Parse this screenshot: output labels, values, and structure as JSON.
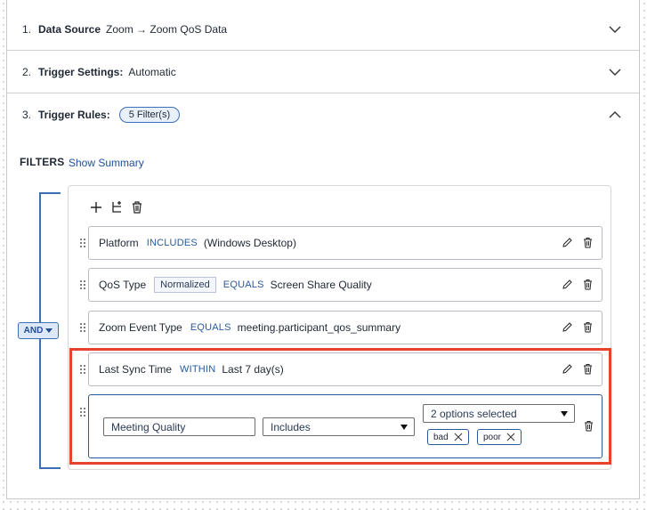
{
  "sections": [
    {
      "number": "1.",
      "title": "Data Source",
      "value": "Zoom → Zoom QoS Data"
    },
    {
      "number": "2.",
      "title": "Trigger Settings:",
      "value": "Automatic"
    },
    {
      "number": "3.",
      "title": "Trigger Rules:",
      "badge": "5 Filter(s)"
    }
  ],
  "filters": {
    "label": "FILTERS",
    "show_summary": "Show Summary",
    "and_label": "AND",
    "rules": [
      {
        "field": "Platform",
        "op": "INCLUDES",
        "value": "(Windows Desktop)"
      },
      {
        "field": "QoS Type",
        "tag": "Normalized",
        "op": "EQUALS",
        "value": "Screen Share Quality"
      },
      {
        "field": "Zoom Event Type",
        "op": "EQUALS",
        "value": "meeting.participant_qos_summary"
      },
      {
        "field": "Last Sync Time",
        "op": "WITHIN",
        "value": "Last 7 day(s)"
      }
    ],
    "editing": {
      "field_value": "Meeting Quality",
      "operator_value": "Includes",
      "options_value": "2 options selected",
      "chips": [
        "bad",
        "poor"
      ]
    }
  },
  "colors": {
    "accent": "#3b6fb6",
    "highlight": "#e8412c",
    "operator": "#2a5a9e"
  }
}
